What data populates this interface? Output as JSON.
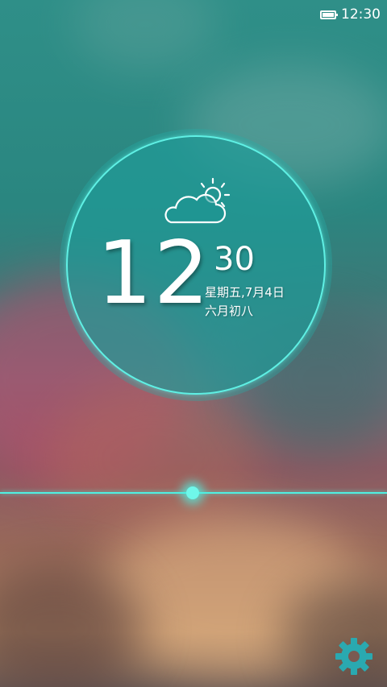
{
  "status_bar": {
    "battery_icon": "battery-full-icon",
    "time": "12:30"
  },
  "clock": {
    "hour": "12",
    "minute": "30",
    "date": "星期五,7月4日",
    "lunar_date": "六月初八",
    "weather_icon": "partly-cloudy-icon"
  },
  "unlock": {
    "handle_icon": "unlock-handle",
    "accent_color": "#4ff0e2"
  },
  "settings": {
    "icon": "gear-icon",
    "color": "#2aa9b0"
  }
}
